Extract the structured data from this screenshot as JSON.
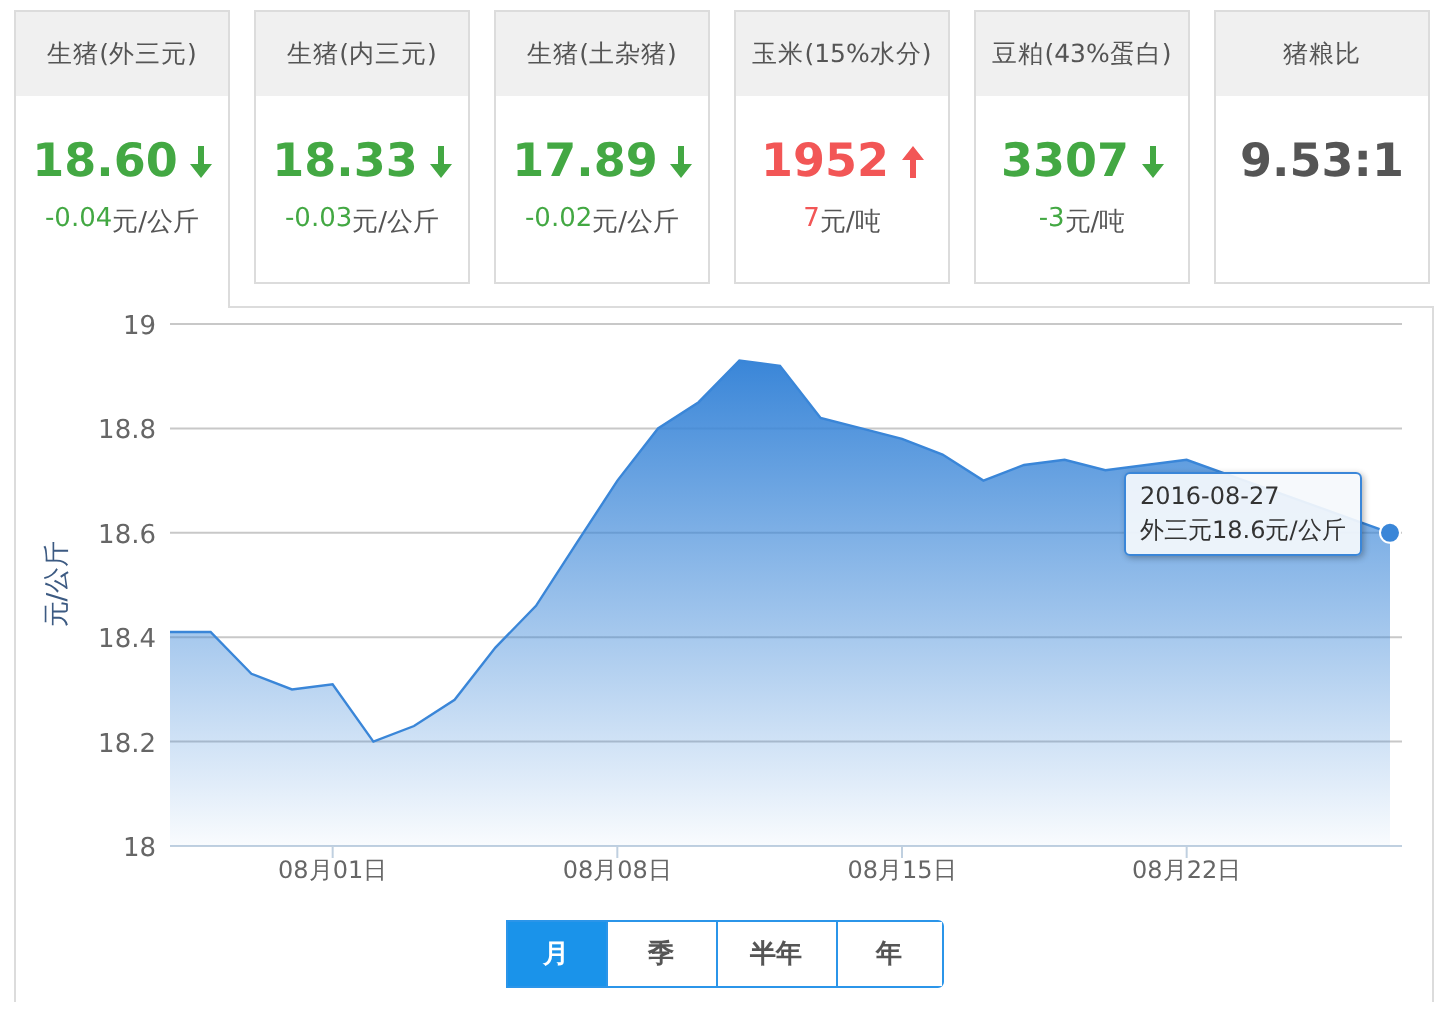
{
  "cards": [
    {
      "title": "生猪(外三元)",
      "value": "18.60",
      "kind": "down",
      "change": "-0.04",
      "unit": "元/公斤",
      "selected": true
    },
    {
      "title": "生猪(内三元)",
      "value": "18.33",
      "kind": "down",
      "change": "-0.03",
      "unit": "元/公斤",
      "selected": false
    },
    {
      "title": "生猪(土杂猪)",
      "value": "17.89",
      "kind": "down",
      "change": "-0.02",
      "unit": "元/公斤",
      "selected": false
    },
    {
      "title": "玉米(15%水分)",
      "value": "1952",
      "kind": "up",
      "change": "7",
      "unit": "元/吨",
      "selected": false
    },
    {
      "title": "豆粕(43%蛋白)",
      "value": "3307",
      "kind": "down",
      "change": "-3",
      "unit": "元/吨",
      "selected": false
    },
    {
      "title": "猪粮比",
      "value": "9.53:1",
      "kind": "flat",
      "selected": false
    }
  ],
  "chart": {
    "chart_data": {
      "type": "area",
      "ylabel": "元/公斤",
      "categories": [
        null,
        null,
        null,
        null,
        "08月01日",
        null,
        null,
        null,
        null,
        null,
        null,
        "08月08日",
        null,
        null,
        null,
        null,
        null,
        null,
        "08月15日",
        null,
        null,
        null,
        null,
        null,
        null,
        "08月22日",
        null,
        null,
        null,
        null,
        null
      ],
      "series": [
        {
          "name": "外三元",
          "color": "#3a86d8",
          "values": [
            18.41,
            18.41,
            18.33,
            18.3,
            18.31,
            18.2,
            18.23,
            18.28,
            18.38,
            18.46,
            18.58,
            18.7,
            18.8,
            18.85,
            18.93,
            18.92,
            18.82,
            18.8,
            18.78,
            18.75,
            18.7,
            18.73,
            18.74,
            18.72,
            null,
            18.74,
            null,
            null,
            null,
            null,
            18.6
          ]
        }
      ],
      "grid": true,
      "ylim": [
        18,
        19
      ],
      "yticks": [
        {
          "value": 18,
          "label": "18"
        },
        {
          "value": 18.2,
          "label": "18.2"
        },
        {
          "value": 18.4,
          "label": "18.4"
        },
        {
          "value": 18.6,
          "label": "18.6"
        },
        {
          "value": 18.8,
          "label": "18.8"
        },
        {
          "value": 19,
          "label": "19"
        }
      ]
    },
    "tooltip": {
      "date": "2016-08-27",
      "value": "18.6元/公斤"
    }
  },
  "periods": [
    {
      "label": "月",
      "selected": true
    },
    {
      "label": "季",
      "selected": false
    },
    {
      "label": "半年",
      "selected": false
    },
    {
      "label": "年",
      "selected": false
    }
  ]
}
